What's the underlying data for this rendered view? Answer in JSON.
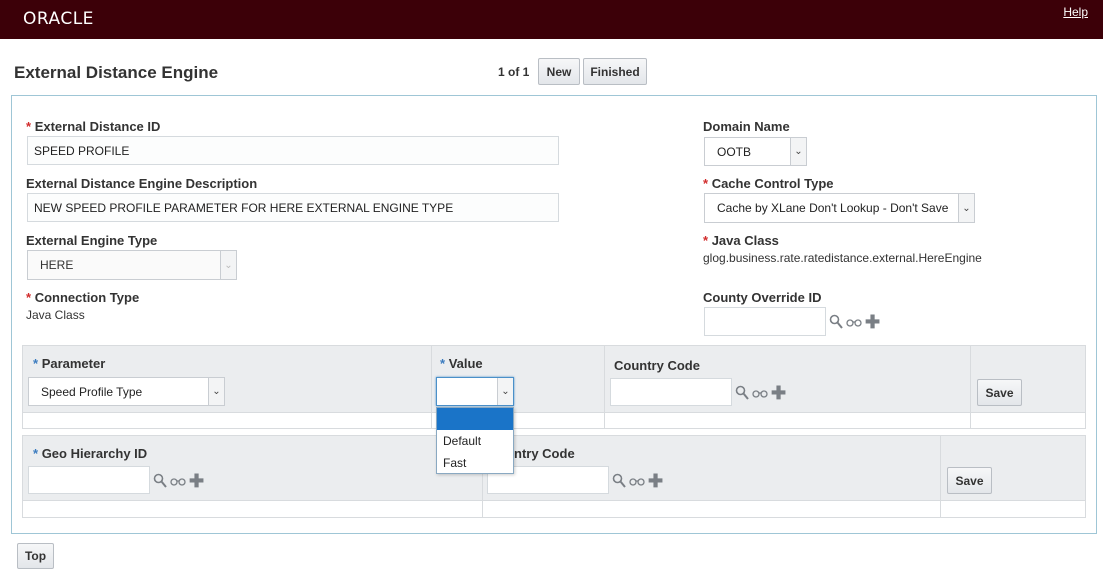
{
  "header": {
    "logo": "ORACLE",
    "help": "Help"
  },
  "page": {
    "title": "External Distance Engine"
  },
  "pager": {
    "text": "1 of 1",
    "new_label": "New",
    "finished_label": "Finished"
  },
  "form": {
    "external_distance_id": {
      "label": "External Distance ID",
      "value": "SPEED PROFILE"
    },
    "description": {
      "label": "External Distance Engine Description",
      "value": "NEW SPEED PROFILE PARAMETER FOR HERE EXTERNAL ENGINE TYPE"
    },
    "engine_type": {
      "label": "External Engine Type",
      "value": "HERE"
    },
    "connection_type": {
      "label": "Connection Type",
      "value": "Java Class"
    },
    "domain_name": {
      "label": "Domain Name",
      "value": "OOTB"
    },
    "cache_control": {
      "label": "Cache Control Type",
      "value": "Cache by XLane Don't Lookup - Don't Save"
    },
    "java_class": {
      "label": "Java Class",
      "value": "glog.business.rate.ratedistance.external.HereEngine"
    },
    "county_override": {
      "label": "County Override ID",
      "value": ""
    }
  },
  "param_grid": {
    "parameter_label": "Parameter",
    "parameter_value": "Speed Profile Type",
    "value_label": "Value",
    "value_value": "",
    "country_code_label": "Country Code",
    "country_code_value": "",
    "save_label": "Save",
    "dropdown_options": [
      "",
      "Default",
      "Fast"
    ]
  },
  "geo_grid": {
    "geo_label": "Geo Hierarchy ID",
    "geo_value": "",
    "country_code_label": "Country Code",
    "country_code_visible": "ntry Code",
    "country_code_value": "",
    "save_label": "Save"
  },
  "footer": {
    "top_label": "Top"
  },
  "icons": {
    "search": "magnifier-icon",
    "view": "glasses-icon",
    "add": "plus-icon"
  },
  "colors": {
    "header_bg": "#3c0008",
    "panel_border": "#9fc6d6",
    "required_red": "#d12b2b",
    "required_blue": "#3a7bbf",
    "selected_option": "#1a74c8"
  }
}
